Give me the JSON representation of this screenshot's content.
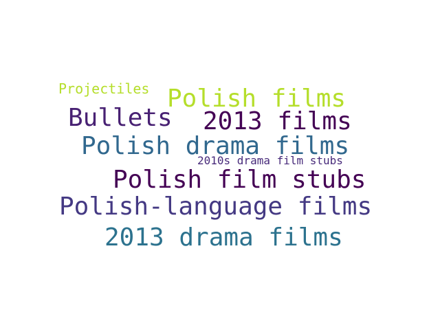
{
  "words": [
    {
      "text": "Projectiles",
      "color": "#b5de2b"
    },
    {
      "text": "Polish films",
      "color": "#b5de2b"
    },
    {
      "text": "Bullets",
      "color": "#482173"
    },
    {
      "text": "2013 films",
      "color": "#440154"
    },
    {
      "text": "Polish drama films",
      "color": "#31688e"
    },
    {
      "text": "2010s drama film stubs",
      "color": "#472a7a"
    },
    {
      "text": "Polish film stubs",
      "color": "#440154"
    },
    {
      "text": "Polish-language films",
      "color": "#443983"
    },
    {
      "text": "2013 drama films",
      "color": "#2c728e"
    }
  ]
}
